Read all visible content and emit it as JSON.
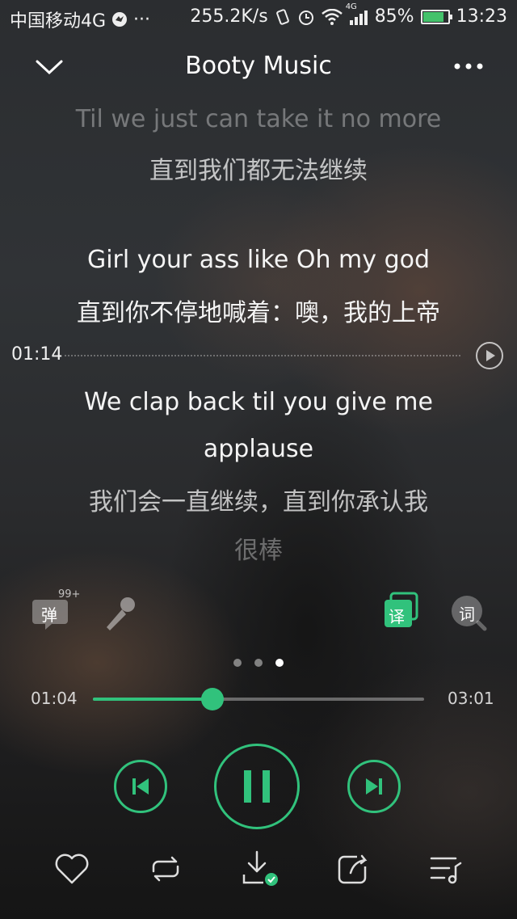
{
  "status_bar": {
    "carrier": "中国移动4G",
    "dots": "···",
    "speed": "255.2K/s",
    "network": "4G",
    "battery": "85%",
    "battery_level": 0.85,
    "time": "13:23"
  },
  "header": {
    "title": "Booty Music"
  },
  "lyrics": {
    "lines": [
      {
        "text": "Til we just can take it no more",
        "style": "dim"
      },
      {
        "text": "直到我们都无法继续",
        "style": "mid"
      },
      {
        "text": "Girl your ass like Oh my god",
        "style": "bright"
      },
      {
        "text": "直到你不停地喊着：噢，我的上帝",
        "style": "bright"
      },
      {
        "text": "We clap back til you give me",
        "style": "bright"
      },
      {
        "text": "applause",
        "style": "bright"
      },
      {
        "text": "我们会一直继续，直到你承认我",
        "style": "mid"
      },
      {
        "text": "很棒",
        "style": "dim"
      }
    ],
    "seek_time": "01:14"
  },
  "tools": {
    "danmu_label": "弹",
    "danmu_count": "99+",
    "translate_label": "译",
    "lyrics_search_label": "词"
  },
  "pager": {
    "count": 3,
    "active": 2
  },
  "progress": {
    "elapsed": "01:04",
    "total": "03:01",
    "fraction": 0.36
  },
  "colors": {
    "accent": "#31c27c"
  }
}
